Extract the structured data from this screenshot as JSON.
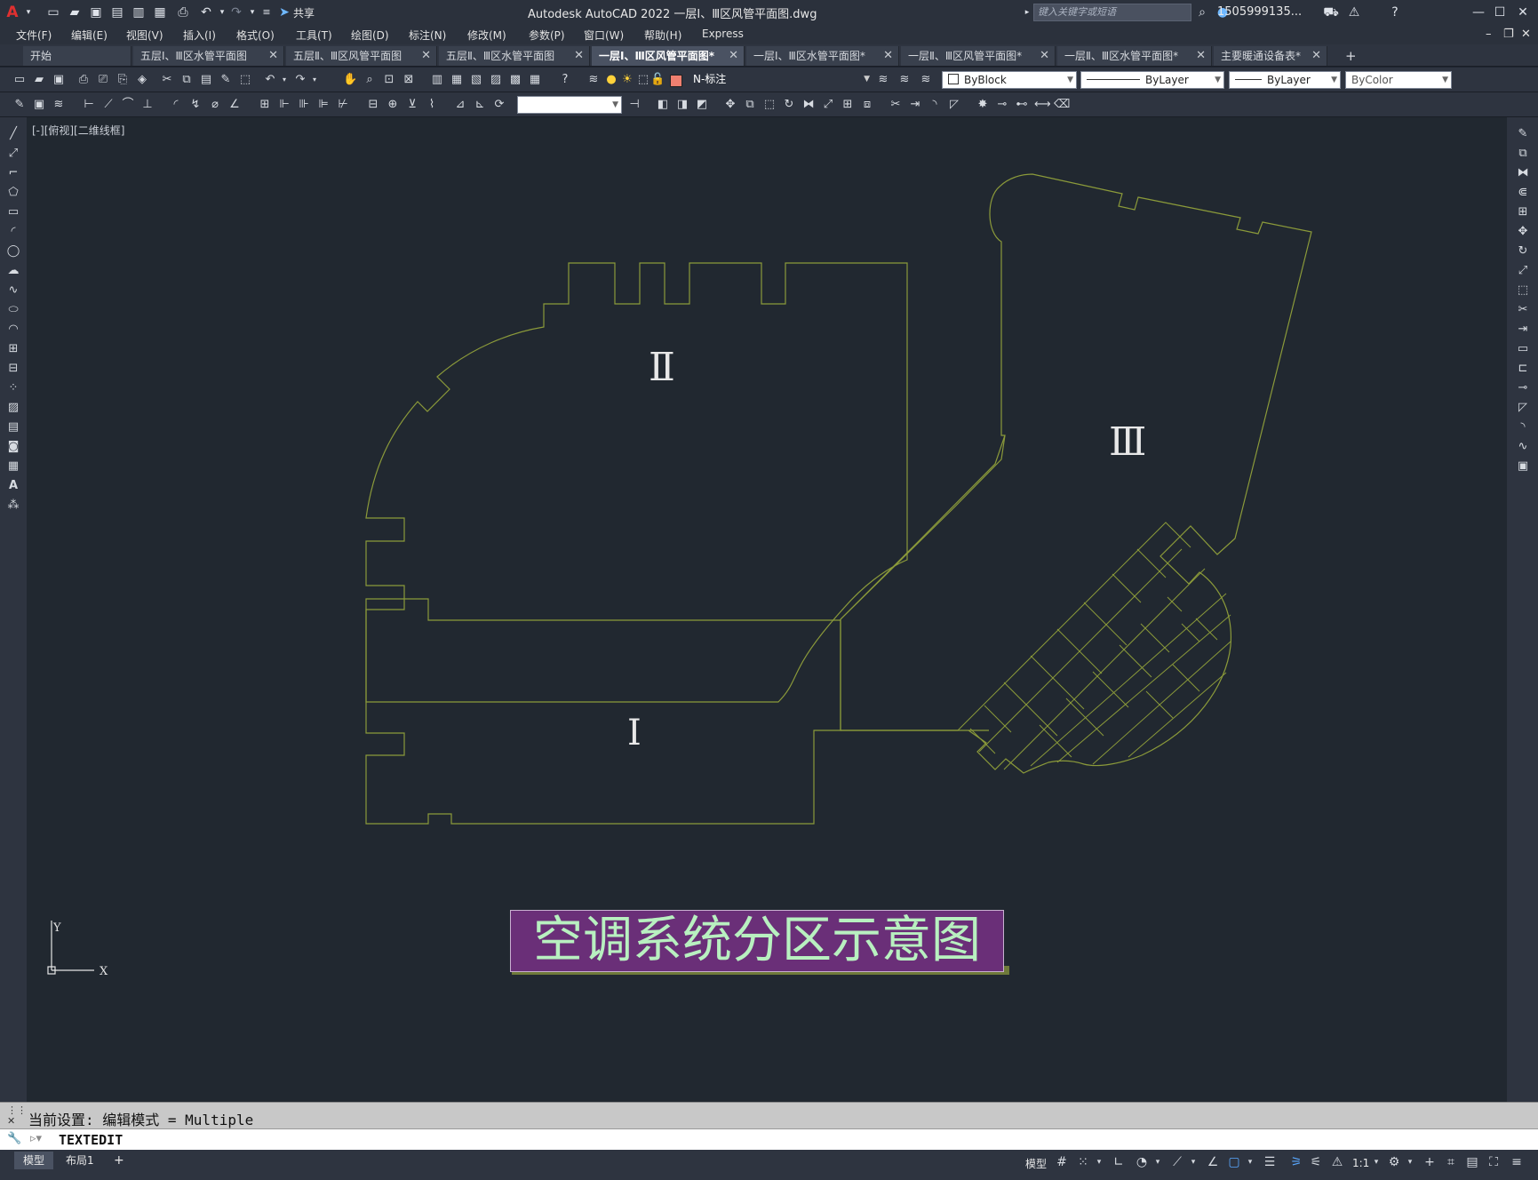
{
  "app": {
    "title": "Autodesk AutoCAD 2022    一层Ⅰ、Ⅲ区风管平面图.dwg",
    "share_label": "共享",
    "search_placeholder": "键入关键字或短语",
    "user": "1505999135...",
    "help_icon": "help-icon"
  },
  "menu": [
    "文件(F)",
    "编辑(E)",
    "视图(V)",
    "插入(I)",
    "格式(O)",
    "工具(T)",
    "绘图(D)",
    "标注(N)",
    "修改(M)",
    "参数(P)",
    "窗口(W)",
    "帮助(H)",
    "Express"
  ],
  "tabs": [
    {
      "label": "开始",
      "active": false,
      "closable": false
    },
    {
      "label": "五层Ⅰ、Ⅲ区水管平面图",
      "active": false,
      "closable": true
    },
    {
      "label": "五层Ⅱ、Ⅲ区风管平面图",
      "active": false,
      "closable": true
    },
    {
      "label": "五层Ⅱ、Ⅲ区水管平面图",
      "active": false,
      "closable": true
    },
    {
      "label": "一层Ⅰ、Ⅲ区风管平面图*",
      "active": true,
      "closable": true
    },
    {
      "label": "一层Ⅰ、Ⅲ区水管平面图*",
      "active": false,
      "closable": true
    },
    {
      "label": "一层Ⅱ、Ⅲ区风管平面图*",
      "active": false,
      "closable": true
    },
    {
      "label": "一层Ⅱ、Ⅲ区水管平面图*",
      "active": false,
      "closable": true
    },
    {
      "label": "主要暖通设备表*",
      "active": false,
      "closable": true
    }
  ],
  "properties": {
    "layer": "N-标注",
    "color": "ByBlock",
    "linetype": "ByLayer",
    "lineweight": "ByLayer",
    "plotstyle": "ByColor",
    "layer_swatch_color": "#f08070"
  },
  "viewport_label": "[-][俯视][二维线框]",
  "drawing": {
    "zone_labels": [
      "Ⅱ",
      "Ⅲ",
      "Ⅰ"
    ],
    "title_text": "空调系统分区示意图",
    "title_bg": "#6a2f78",
    "title_fg": "#b8f0c0",
    "outline_color": "#8b9a3a"
  },
  "command": {
    "history": "当前设置: 编辑模式 = Multiple",
    "input": "TEXTEDIT"
  },
  "status": {
    "layout_tabs": [
      "模型",
      "布局1"
    ],
    "model_label": "模型",
    "scale": "1:1"
  }
}
